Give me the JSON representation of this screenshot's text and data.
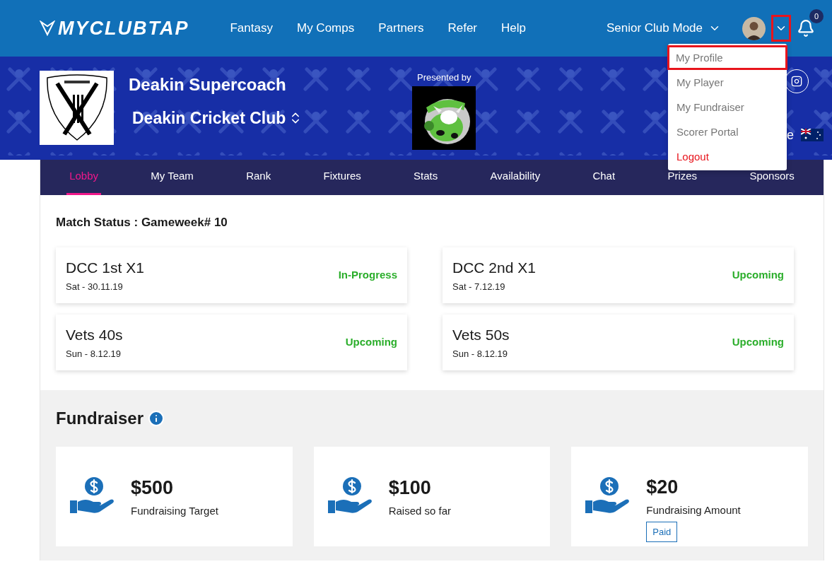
{
  "brand": {
    "logo_text": "MYCLUBTAP"
  },
  "nav": [
    "Fantasy",
    "My Comps",
    "Partners",
    "Refer",
    "Help"
  ],
  "mode_selector": {
    "label": "Senior Club Mode"
  },
  "account_caret": {
    "highlighted": true
  },
  "notifications": {
    "count": "0"
  },
  "account_menu": {
    "items": [
      {
        "label": "My Profile",
        "kind": "link",
        "highlighted": true
      },
      {
        "label": "My Player",
        "kind": "link",
        "highlighted": false
      },
      {
        "label": "My Fundraiser",
        "kind": "link",
        "highlighted": false
      },
      {
        "label": "Scorer Portal",
        "kind": "link",
        "highlighted": false
      },
      {
        "label": "Logout",
        "kind": "danger",
        "highlighted": false
      }
    ]
  },
  "club": {
    "competition": "Deakin Supercoach",
    "name": "Deakin Cricket Club"
  },
  "sponsor": {
    "caption": "Presented by"
  },
  "partial_text": "e",
  "tabs": [
    {
      "label": "Lobby",
      "selected": true
    },
    {
      "label": "My Team",
      "selected": false
    },
    {
      "label": "Rank",
      "selected": false
    },
    {
      "label": "Fixtures",
      "selected": false
    },
    {
      "label": "Stats",
      "selected": false
    },
    {
      "label": "Availability",
      "selected": false
    },
    {
      "label": "Chat",
      "selected": false
    },
    {
      "label": "Prizes",
      "selected": false
    },
    {
      "label": "Sponsors",
      "selected": false
    }
  ],
  "match_status": {
    "title": "Match Status : Gameweek# 10",
    "matches": [
      {
        "team": "DCC 1st X1",
        "date": "Sat - 30.11.19",
        "status": "In-Progress"
      },
      {
        "team": "DCC 2nd X1",
        "date": "Sat - 7.12.19",
        "status": "Upcoming"
      },
      {
        "team": "Vets 40s",
        "date": "Sun - 8.12.19",
        "status": "Upcoming"
      },
      {
        "team": "Vets 50s",
        "date": "Sun - 8.12.19",
        "status": "Upcoming"
      }
    ]
  },
  "fundraiser": {
    "title": "Fundraiser",
    "cards": [
      {
        "amount": "$500",
        "label": "Fundraising Target"
      },
      {
        "amount": "$100",
        "label": "Raised so far"
      },
      {
        "amount": "$20",
        "label": "Fundraising Amount",
        "badge": "Paid"
      }
    ]
  }
}
